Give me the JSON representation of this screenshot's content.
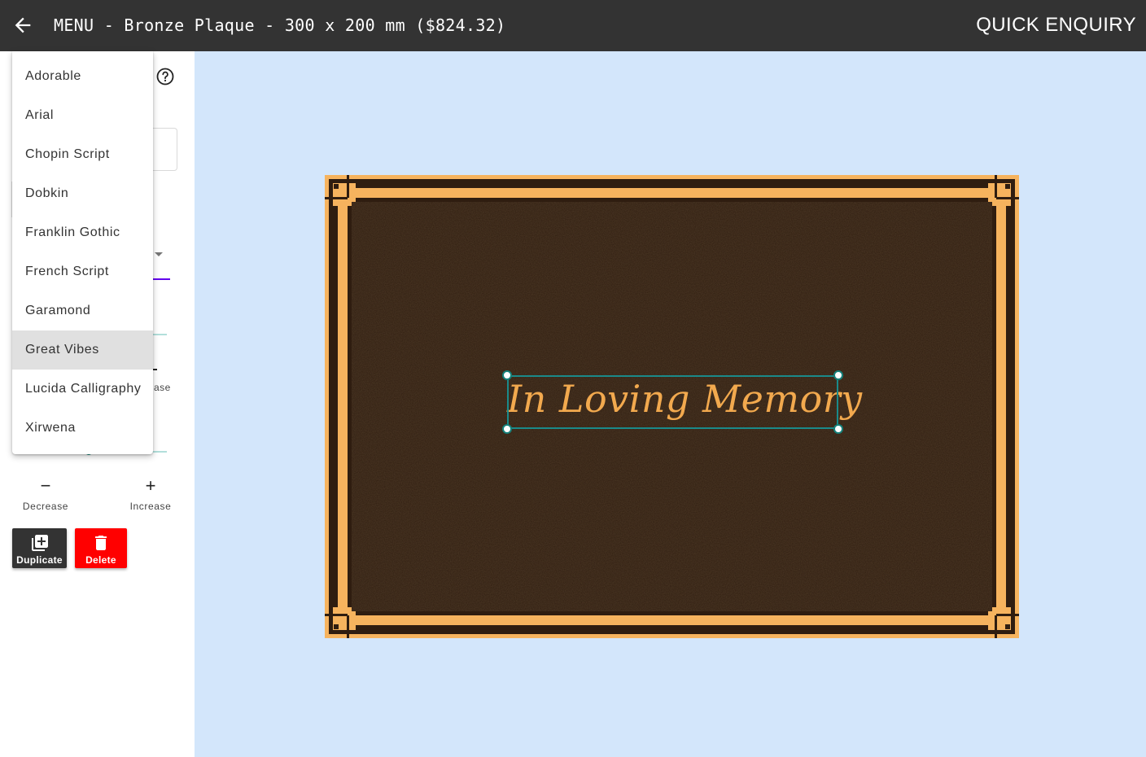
{
  "header": {
    "title": "MENU - Bronze Plaque - 300 x 200 mm ($824.32)",
    "quick_enquiry_label": "QUICK ENQUIRY"
  },
  "sidebar": {
    "partial_label_ease": "ase",
    "decrease_label": "Decrease",
    "increase_label": "Increase",
    "duplicate_label": "Duplicate",
    "delete_label": "Delete"
  },
  "font_dropdown": {
    "items": [
      "Adorable",
      "Arial",
      "Chopin Script",
      "Dobkin",
      "Franklin Gothic",
      "French Script",
      "Garamond",
      "Great Vibes",
      "Lucida Calligraphy",
      "Xirwena"
    ],
    "selected": "Great Vibes"
  },
  "plaque": {
    "text": "In Loving Memory"
  },
  "colors": {
    "topbar": "#333333",
    "canvas_bg": "#d3e6fb",
    "plaque_bronze": "#2f1d10",
    "plaque_gold": "#f6b35e",
    "selection": "#1a8a8a",
    "delete": "#ff0000"
  },
  "icons": {
    "back": "arrow-left-icon",
    "help": "help-circle-icon",
    "duplicate": "library-add-icon",
    "delete": "trash-icon",
    "decrease": "minus-icon",
    "increase": "plus-icon"
  }
}
